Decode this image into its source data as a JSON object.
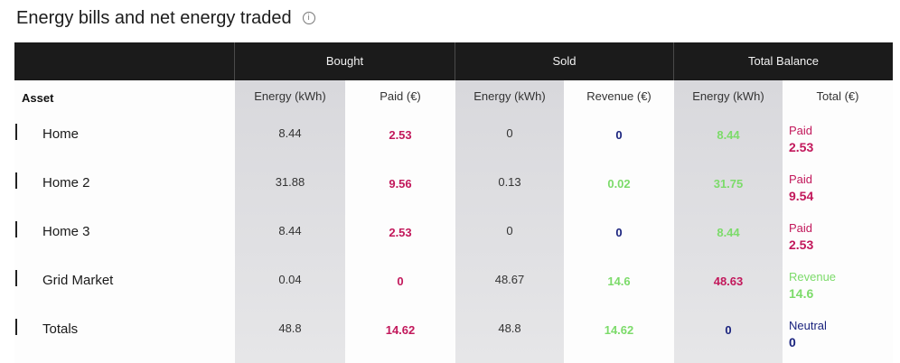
{
  "header": {
    "title": "Energy bills and net energy traded",
    "info_icon": "info-icon"
  },
  "table": {
    "groups": {
      "bought": "Bought",
      "sold": "Sold",
      "balance": "Total Balance"
    },
    "columns": {
      "asset": "Asset",
      "bought_energy": "Energy (kWh)",
      "bought_paid": "Paid (€)",
      "sold_energy": "Energy (kWh)",
      "sold_revenue": "Revenue (€)",
      "balance_energy": "Energy (kWh)",
      "balance_total": "Total (€)"
    },
    "rows": [
      {
        "asset": "Home",
        "bought_energy": "8.44",
        "bought_paid": "2.53",
        "sold_energy": "0",
        "sold_revenue": "0",
        "balance_energy": "8.44",
        "total_label": "Paid",
        "total_value": "2.53"
      },
      {
        "asset": "Home 2",
        "bought_energy": "31.88",
        "bought_paid": "9.56",
        "sold_energy": "0.13",
        "sold_revenue": "0.02",
        "balance_energy": "31.75",
        "total_label": "Paid",
        "total_value": "9.54"
      },
      {
        "asset": "Home 3",
        "bought_energy": "8.44",
        "bought_paid": "2.53",
        "sold_energy": "0",
        "sold_revenue": "0",
        "balance_energy": "8.44",
        "total_label": "Paid",
        "total_value": "2.53"
      },
      {
        "asset": "Grid Market",
        "bought_energy": "0.04",
        "bought_paid": "0",
        "sold_energy": "48.67",
        "sold_revenue": "14.6",
        "balance_energy": "48.63",
        "total_label": "Revenue",
        "total_value": "14.6"
      },
      {
        "asset": "Totals",
        "bought_energy": "48.8",
        "bought_paid": "14.62",
        "sold_energy": "48.8",
        "sold_revenue": "14.62",
        "balance_energy": "0",
        "total_label": "Neutral",
        "total_value": "0"
      }
    ]
  },
  "colors": {
    "paid": "#c2185b",
    "revenue": "#7cdb6a",
    "neutral": "#1a237e",
    "header_bg": "#1b1b1b"
  }
}
